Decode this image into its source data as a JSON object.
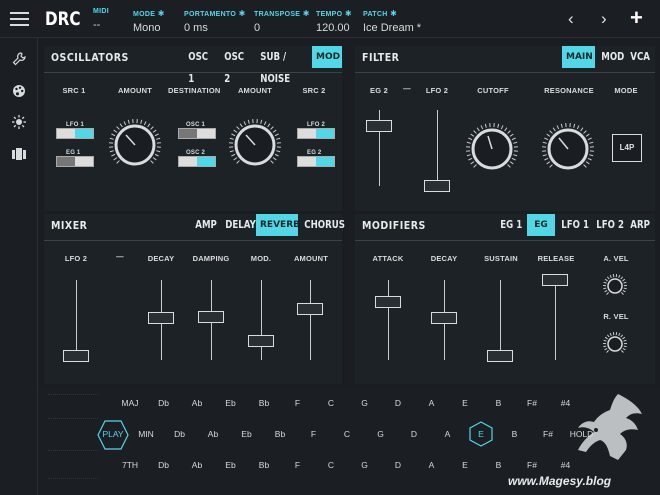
{
  "header": {
    "brand": "DRC",
    "fields": [
      {
        "label": "MIDI",
        "value": "--"
      },
      {
        "label": "MODE",
        "value": "Mono"
      },
      {
        "label": "PORTAMENTO",
        "value": "0 ms"
      },
      {
        "label": "TRANSPOSE",
        "value": "0"
      },
      {
        "label": "TEMPO",
        "value": "120.00"
      },
      {
        "label": "PATCH",
        "value": "Ice Dream *"
      }
    ]
  },
  "sidebar": {
    "icons": [
      "wrench-icon",
      "palette-icon",
      "sun-icon",
      "library-icon"
    ]
  },
  "oscillators": {
    "title": "OSCILLATORS",
    "tabs": [
      "OSC 1",
      "OSC 2",
      "SUB / NOISE",
      "MOD"
    ],
    "active_tab": "MOD",
    "labels": [
      "SRC 1",
      "AMOUNT",
      "DESTINATION",
      "AMOUNT",
      "SRC 2"
    ],
    "src1": [
      "LFO 1",
      "EG 1"
    ],
    "destination": [
      "OSC 1",
      "OSC 2"
    ],
    "src2": [
      "LFO 2",
      "EG 2"
    ]
  },
  "filter": {
    "title": "FILTER",
    "tabs": [
      "MAIN",
      "MOD",
      "VCA"
    ],
    "active_tab": "MAIN",
    "labels": [
      "EG 2",
      "—",
      "LFO 2",
      "CUTOFF",
      "RESONANCE",
      "MODE"
    ],
    "mode_value": "L4P"
  },
  "mixer": {
    "title": "MIXER",
    "tabs": [
      "AMP",
      "DELAY",
      "REVERB",
      "CHORUS"
    ],
    "active_tab": "REVERB",
    "labels": [
      "LFO 2",
      "—",
      "DECAY",
      "DAMPING",
      "MOD.",
      "AMOUNT"
    ]
  },
  "modifiers": {
    "title": "MODIFIERS",
    "tabs": [
      "EG 1",
      "EG 2",
      "LFO 1",
      "LFO 2",
      "ARP"
    ],
    "active_tab": "EG 2",
    "labels": [
      "ATTACK",
      "DECAY",
      "SUSTAIN",
      "RELEASE"
    ],
    "vel_labels": [
      "A. VEL",
      "R. VEL"
    ]
  },
  "keyboard": {
    "play_label": "PLAY",
    "row1": [
      "MAJ",
      "Db",
      "Ab",
      "Eb",
      "Bb",
      "F",
      "C",
      "G",
      "D",
      "A",
      "E",
      "B",
      "F#",
      "#4"
    ],
    "row2": [
      "MIN",
      "Db",
      "Ab",
      "Eb",
      "Bb",
      "F",
      "C",
      "G",
      "D",
      "A",
      "E",
      "B",
      "F#",
      "HOLD"
    ],
    "row3": [
      "7TH",
      "Db",
      "Ab",
      "Eb",
      "Bb",
      "F",
      "C",
      "G",
      "D",
      "A",
      "E",
      "B",
      "F#",
      "#4"
    ],
    "selected": "E"
  },
  "watermark": "www.Magesy.blog",
  "colors": {
    "accent": "#4fd9e6",
    "background": "#1a1e22",
    "panel": "#1d2226"
  }
}
